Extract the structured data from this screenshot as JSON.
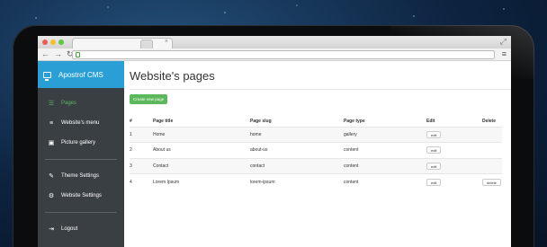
{
  "browser": {
    "title_dots": [
      "#ee5c54",
      "#f3bf2f",
      "#5bc83f"
    ]
  },
  "brand": {
    "label": "Apostrof CMS",
    "icon": "monitor-icon"
  },
  "sidebar": {
    "items": [
      {
        "label": "Pages",
        "icon": "list-icon",
        "active": true
      },
      {
        "label": "Website's menu",
        "icon": "menu-icon"
      },
      {
        "label": "Picture gallery",
        "icon": "image-icon"
      },
      {
        "label": "Theme Settings",
        "icon": "palette-icon"
      },
      {
        "label": "Website Settings",
        "icon": "cogs-icon"
      },
      {
        "label": "Logout",
        "icon": "logout-icon"
      }
    ]
  },
  "main": {
    "title": "Website's pages",
    "create_button": "Create new page",
    "table": {
      "headers": [
        "#",
        "Page title",
        "Page slug",
        "Page type",
        "Edit",
        "Delete"
      ],
      "rows": [
        {
          "num": "1",
          "title": "Home",
          "slug": "home",
          "type": "gallery",
          "edit": "edit",
          "delete": ""
        },
        {
          "num": "2",
          "title": "About us",
          "slug": "about-us",
          "type": "content",
          "edit": "edit",
          "delete": ""
        },
        {
          "num": "3",
          "title": "Contact",
          "slug": "contact",
          "type": "content",
          "edit": "edit",
          "delete": ""
        },
        {
          "num": "4",
          "title": "Lorem Ipsum",
          "slug": "lorem-ipsum",
          "type": "content",
          "edit": "edit",
          "delete": "delete"
        }
      ]
    }
  },
  "colors": {
    "brand_bar": "#2a9fd6",
    "sidebar_bg": "#3a3f44",
    "active_item": "#5cb85c",
    "create_button": "#5cb85c"
  }
}
